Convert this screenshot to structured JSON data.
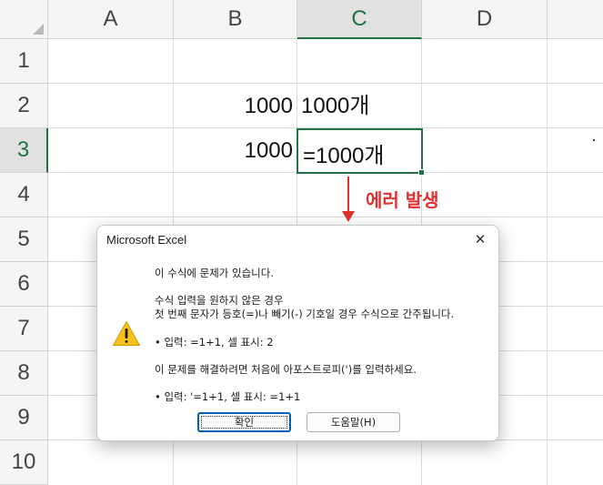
{
  "spreadsheet": {
    "columns": [
      "A",
      "B",
      "C",
      "D"
    ],
    "rows": [
      "1",
      "2",
      "3",
      "4",
      "5",
      "6",
      "7",
      "8",
      "9",
      "10"
    ],
    "selected_column": "C",
    "selected_row": "3",
    "cells": {
      "B2": "1000",
      "C2": "1000개",
      "B3": "1000",
      "C3": "=1000개"
    }
  },
  "annotation": {
    "label": "에러 발생",
    "color": "#e03030"
  },
  "dialog": {
    "title": "Microsoft Excel",
    "close_label": "✕",
    "icon": "warning-icon",
    "lines": {
      "l1": "이 수식에 문제가 있습니다.",
      "l2": "수식 입력을 원하지 않은 경우",
      "l3": "첫 번째 문자가 등호(=)나 빼기(-) 기호일 경우 수식으로 간주됩니다.",
      "l4": "• 입력:   =1+1, 셀 표시:   2",
      "l5": "이 문제를 해결하려면 처음에 아포스트로피(')를 입력하세요.",
      "l6": "• 입력:   '=1+1, 셀 표시:   =1+1"
    },
    "ok_label": "확인",
    "help_label": "도움말(H)"
  },
  "colors": {
    "accent": "#217346",
    "focus_blue": "#005fb8",
    "warning_yellow": "#f7c21b"
  }
}
